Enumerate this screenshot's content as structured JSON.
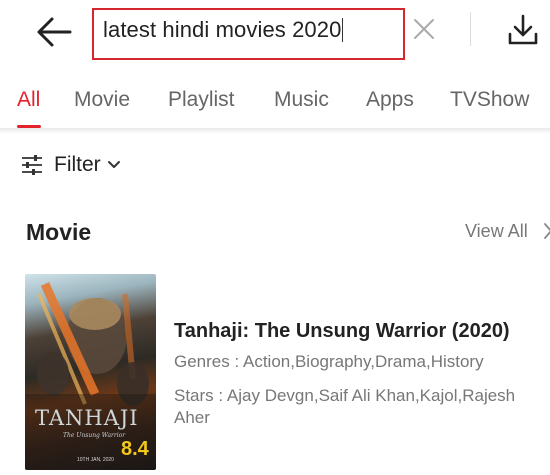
{
  "header": {
    "search_query": "latest hindi movies 2020",
    "back_icon": "arrow-left-icon",
    "clear_icon": "close-icon",
    "download_icon": "download-icon"
  },
  "tabs": [
    {
      "label": "All",
      "active": true
    },
    {
      "label": "Movie",
      "active": false
    },
    {
      "label": "Playlist",
      "active": false
    },
    {
      "label": "Music",
      "active": false
    },
    {
      "label": "Apps",
      "active": false
    },
    {
      "label": "TVShow",
      "active": false
    }
  ],
  "filter": {
    "label": "Filter",
    "icon": "sliders-icon"
  },
  "section": {
    "title": "Movie",
    "view_all": "View All"
  },
  "results": [
    {
      "title": "Tanhaji: The Unsung Warrior (2020)",
      "genres": "Genres : Action,Biography,Drama,History",
      "stars": "Stars : Ajay Devgn,Saif Ali Khan,Kajol,Rajesh Aher",
      "poster": {
        "title": "TANHAJI",
        "subtitle": "The Unsung Warrior",
        "date": "10TH JAN, 2020",
        "rating": "8.4"
      }
    }
  ],
  "colors": {
    "accent": "#e2232b",
    "search_border": "#d6262e",
    "rating": "#f2c81c"
  }
}
